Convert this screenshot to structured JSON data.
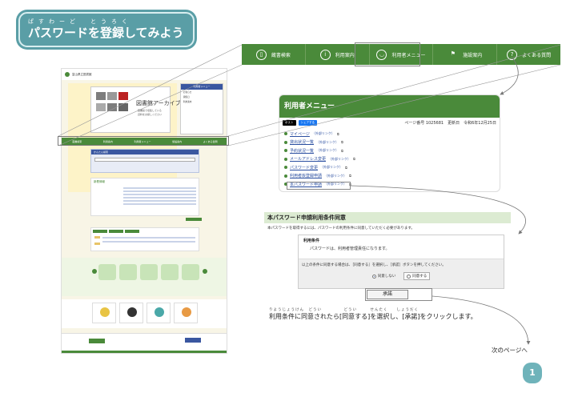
{
  "title": {
    "ruby": "ぱすわーど　とうろく",
    "text": "パスワードを登録してみよう"
  },
  "thumbnail": {
    "site_name": "富山県立図書館",
    "archive_title": "図書館アーカイブ",
    "archive_sub1": "図書館で収集している",
    "archive_sub2": "資料をお探しください",
    "side_head": "利用者メニュー",
    "side_items": [
      "お知らせ",
      "開館日",
      "利用案内"
    ],
    "nav_items": [
      "蔵書検索",
      "利用案内",
      "利用者メニュー",
      "施設案内",
      "よくある質問"
    ],
    "search_bar": "かんたん検索",
    "news_title": "新着情報"
  },
  "navbar": {
    "items": [
      {
        "label": "蔵書検索",
        "icon": "book-icon"
      },
      {
        "label": "利用案内",
        "icon": "info-icon"
      },
      {
        "label": "利用者メニュー",
        "icon": "person-icon"
      },
      {
        "label": "施設案内",
        "icon": "flag-icon"
      },
      {
        "label": "よくある質問",
        "icon": "question-icon"
      }
    ]
  },
  "user_menu": {
    "title": "利用者メニュー",
    "sns": [
      "ポスト",
      "シェアする"
    ],
    "meta": "ページ番号 1025681　更新日　令和6年12月25日",
    "links": [
      {
        "label": "マイページ",
        "suffix": "（外部リンク）"
      },
      {
        "label": "貸出状況一覧",
        "suffix": "（外部リンク）"
      },
      {
        "label": "予約状況一覧",
        "suffix": "（外部リンク）"
      },
      {
        "label": "メールアドレス変更",
        "suffix": "（外部リンク）"
      },
      {
        "label": "パスワード変更",
        "suffix": "（外部リンク）"
      },
      {
        "label": "利用者仮登録申請",
        "suffix": "（外部リンク）"
      },
      {
        "label": "本パスワード申請",
        "suffix": "（外部リンク）"
      }
    ]
  },
  "conditions": {
    "title": "本パスワード申請利用条件同意",
    "intro": "本パスワードを取得するには、パスワードの利用条件に同意していただく必要があります。",
    "box_head": "利用条件",
    "box_body": "パスワードは、利用者管理責任になります。",
    "instruction": "以上の条件に同意する場合は、［同意する］を選択し、［承認］ボタンを押してください。",
    "option_disagree": "同意しない",
    "option_agree": "同意する",
    "approve_label": "承諾"
  },
  "instruction": {
    "ruby": "りようじょうけん　どうい　　　　　どうい　　　せんたく　　しょうだく",
    "text": "利用条件に同意されたら[同意する]を選択し、[承諾]をクリックします。"
  },
  "next_page": "次のページへ",
  "page_number": "1",
  "colors": {
    "green": "#4a8a3a",
    "teal": "#5a9ea6",
    "navy": "#3a57a0"
  }
}
